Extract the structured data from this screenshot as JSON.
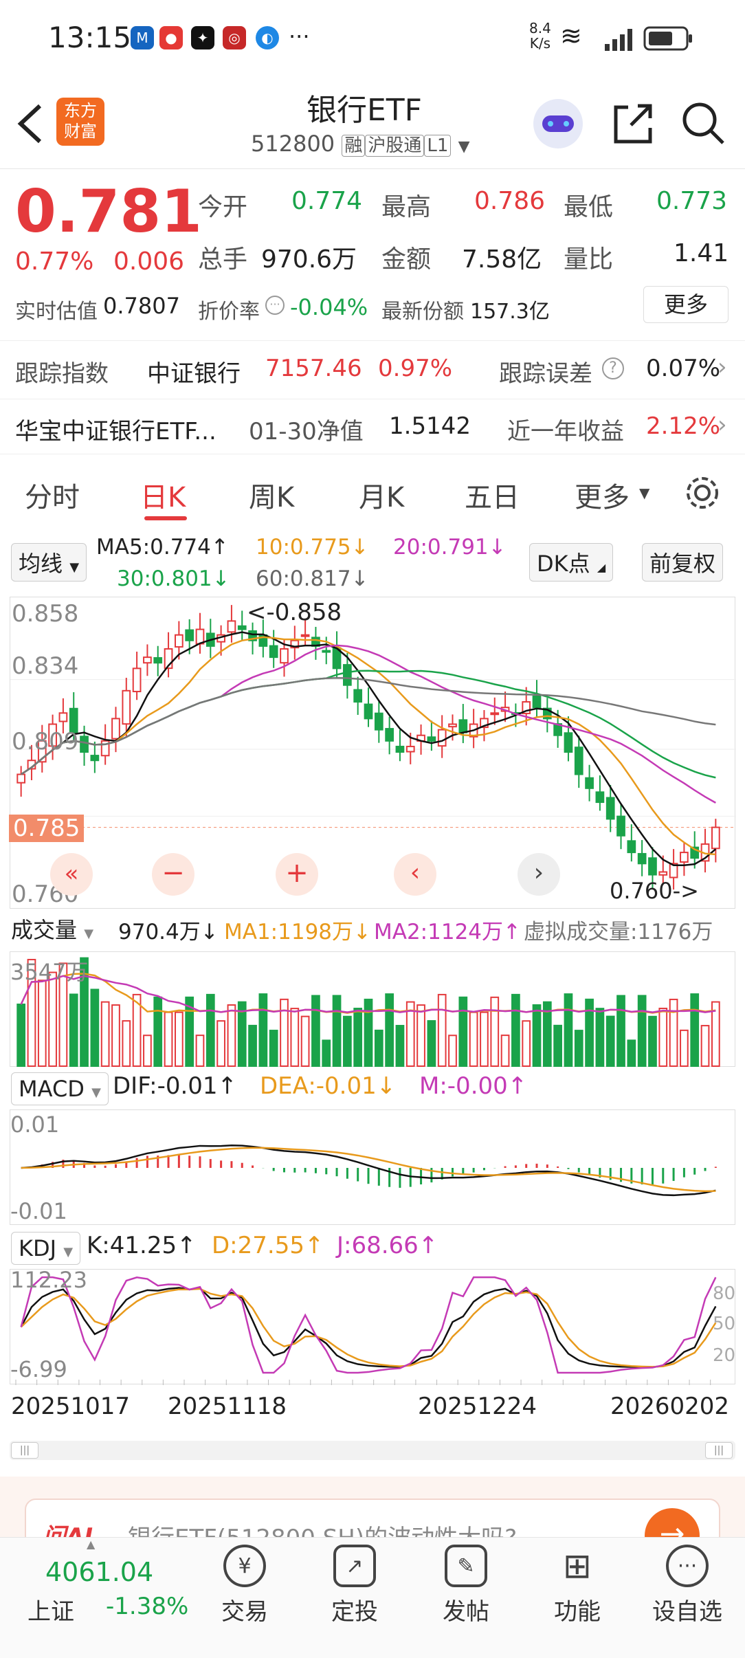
{
  "status": {
    "time": "13:15",
    "net_speed_top": "8.4",
    "net_speed_bottom": "K/s",
    "signal": "6"
  },
  "header": {
    "title": "银行ETF",
    "code": "512800",
    "tag1": "融",
    "tag2": "沪股通",
    "tag3": "L1",
    "logo_line1": "东方",
    "logo_line2": "财富"
  },
  "quote": {
    "price": "0.781",
    "pct": "0.77%",
    "chg": "0.006",
    "open_label": "今开",
    "open": "0.774",
    "high_label": "最高",
    "high": "0.786",
    "low_label": "最低",
    "low": "0.773",
    "vol_label": "总手",
    "vol": "970.6万",
    "amt_label": "金额",
    "amt": "7.58亿",
    "ratio_label": "量比",
    "ratio": "1.41",
    "est_label": "实时估值",
    "est": "0.7807",
    "prem_label": "折价率",
    "prem": "-0.04%",
    "share_label": "最新份额",
    "share": "157.3亿",
    "more": "更多"
  },
  "tracking": {
    "label": "跟踪指数",
    "index": "中证银行",
    "value": "7157.46",
    "pct": "0.97%",
    "err_label": "跟踪误差",
    "err": "0.07%"
  },
  "fund": {
    "name": "华宝中证银行ETF...",
    "nav_label": "01-30净值",
    "nav": "1.5142",
    "ret_label": "近一年收益",
    "ret": "2.12%"
  },
  "tabs": [
    "分时",
    "日K",
    "周K",
    "月K",
    "五日",
    "更多"
  ],
  "ma": {
    "type": "均线",
    "ma5": "MA5:0.774↑",
    "ma10": "10:0.775↓",
    "ma20": "20:0.791↓",
    "ma30": "30:0.801↓",
    "ma60": "60:0.817↓",
    "dk": "DK点",
    "fq": "前复权"
  },
  "price_axis": {
    "top": "0.858",
    "l2": "0.834",
    "l3": "0.809",
    "l4": "0.785",
    "bottom": "0.760",
    "cur": "0.785",
    "high_mark": "<-0.858",
    "low_mark": "0.760->"
  },
  "volume": {
    "type": "成交量",
    "val": "970.4万↓",
    "ma1": "MA1:1198万↓",
    "ma2": "MA2:1124万↑",
    "virtual": "虚拟成交量:1176万",
    "top": "3547万"
  },
  "macd": {
    "type": "MACD",
    "dif": "DIF:-0.01↑",
    "dea": "DEA:-0.01↓",
    "m": "M:-0.00↑",
    "top": "0.01",
    "bottom": "-0.01"
  },
  "kdj": {
    "type": "KDJ",
    "k": "K:41.25↑",
    "d": "D:27.55↑",
    "j": "J:68.66↑",
    "top": "112.23",
    "bottom": "-6.99",
    "l80": "80",
    "l50": "50",
    "l20": "20"
  },
  "dates": [
    "20251017",
    "20251118",
    "20251224",
    "20260202"
  ],
  "ai": {
    "text": "银行ETF(512800.SH)的波动性大吗?",
    "brand": "问AI"
  },
  "bottom": {
    "index_val": "4061.04",
    "index_name": "上证",
    "index_pct": "-1.38%",
    "items": [
      "交易",
      "定投",
      "发帖",
      "功能",
      "设自选"
    ]
  },
  "colors": {
    "up": "#e4393c",
    "down": "#1aa34a"
  },
  "chart_data": {
    "type": "candlestick",
    "description_source": "daily K chart",
    "close": [
      0.8,
      0.805,
      0.812,
      0.818,
      0.822,
      0.815,
      0.808,
      0.805,
      0.812,
      0.82,
      0.83,
      0.838,
      0.842,
      0.84,
      0.845,
      0.85,
      0.848,
      0.852,
      0.846,
      0.85,
      0.855,
      0.852,
      0.848,
      0.846,
      0.842,
      0.845,
      0.848,
      0.85,
      0.846,
      0.844,
      0.838,
      0.832,
      0.826,
      0.82,
      0.816,
      0.812,
      0.808,
      0.81,
      0.814,
      0.812,
      0.816,
      0.818,
      0.815,
      0.818,
      0.82,
      0.822,
      0.824,
      0.822,
      0.826,
      0.824,
      0.82,
      0.814,
      0.808,
      0.8,
      0.795,
      0.79,
      0.784,
      0.778,
      0.772,
      0.768,
      0.764,
      0.765,
      0.768,
      0.772,
      0.77,
      0.775,
      0.781
    ]
  }
}
